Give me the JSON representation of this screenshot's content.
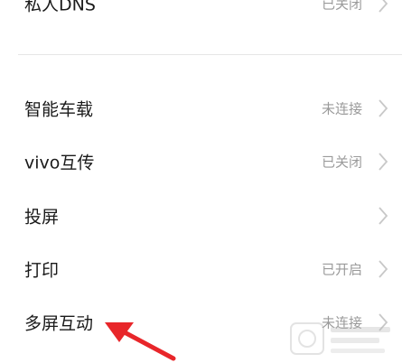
{
  "settings": {
    "items": [
      {
        "label": "私人DNS",
        "status": "已关闭"
      },
      {
        "label": "智能车载",
        "status": "未连接"
      },
      {
        "label": "vivo互传",
        "status": "已关闭"
      },
      {
        "label": "投屏",
        "status": ""
      },
      {
        "label": "打印",
        "status": "已开启"
      },
      {
        "label": "多屏互动",
        "status": "未连接"
      }
    ]
  },
  "annotation": {
    "arrow_color": "#e8262a"
  },
  "colors": {
    "label": "#1a1a1a",
    "status": "#9a9a9a",
    "divider": "#e6e6e6"
  }
}
